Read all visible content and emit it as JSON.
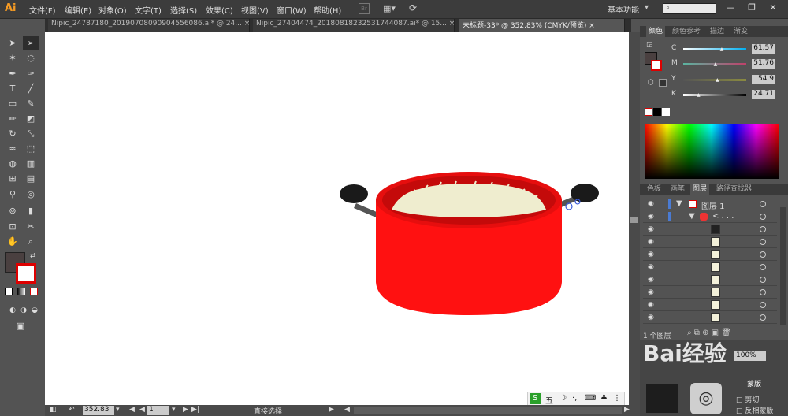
{
  "app": {
    "logo": "Ai",
    "workspace": "基本功能"
  },
  "menu": [
    "文件(F)",
    "编辑(E)",
    "对象(O)",
    "文字(T)",
    "选择(S)",
    "效果(C)",
    "视图(V)",
    "窗口(W)",
    "帮助(H)"
  ],
  "tabs": [
    {
      "label": "Nipic_24787180_20190708090904556086.ai* @ 24..."
    },
    {
      "label": "Nipic_27404474_20180818232531744087.ai* @ 15..."
    },
    {
      "label": "未标题-33* @ 352.83% (CMYK/预览)"
    }
  ],
  "color_panel": {
    "tabs": [
      "颜色",
      "颜色参考",
      "描边",
      "渐变"
    ],
    "sliders": [
      {
        "label": "C",
        "value": "61.57",
        "grad": "linear-gradient(to right,#fff,#00aeef)",
        "pos": 0.62
      },
      {
        "label": "M",
        "value": "51.76",
        "grad": "linear-gradient(to right,#5ab4a0,#c0406a)",
        "pos": 0.52
      },
      {
        "label": "Y",
        "value": "54.9",
        "grad": "linear-gradient(to right,#555,#8a8a40)",
        "pos": 0.55
      },
      {
        "label": "K",
        "value": "24.71",
        "grad": "linear-gradient(to right,#fff,#000)",
        "pos": 0.25
      }
    ]
  },
  "layers_panel": {
    "tabs": [
      "色板",
      "画笔",
      "图层",
      "路径查找器"
    ],
    "layer_name": "图层 1",
    "group_label": "< . . .",
    "count": "1 个图层"
  },
  "navigator": {
    "zoom": "100%",
    "label1": "剪切",
    "label2": "反相蒙版",
    "btn": "蒙版"
  },
  "status": {
    "zoom": "352.83",
    "page": "1",
    "tool": "直接选择"
  },
  "ime": {
    "label": "五"
  },
  "watermark": "Bai经验"
}
